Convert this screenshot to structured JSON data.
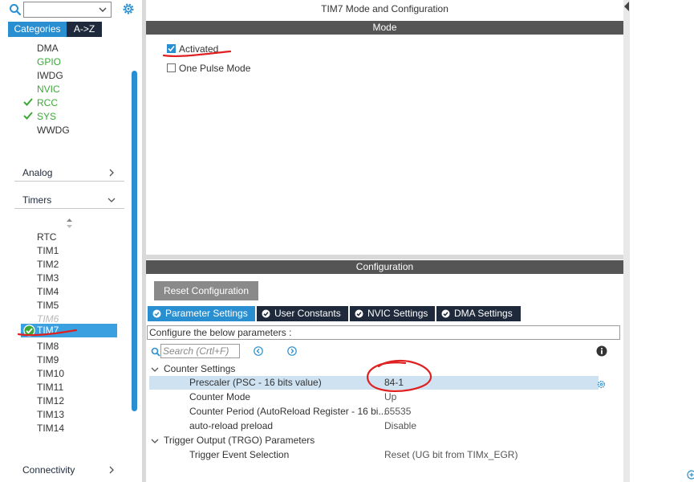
{
  "left_panel": {
    "tabs": {
      "categories": "Categories",
      "az": "A->Z"
    },
    "system_core_items": [
      {
        "label": "DMA",
        "status": "none"
      },
      {
        "label": "GPIO",
        "status": "green"
      },
      {
        "label": "IWDG",
        "status": "none"
      },
      {
        "label": "NVIC",
        "status": "green"
      },
      {
        "label": "RCC",
        "status": "checked"
      },
      {
        "label": "SYS",
        "status": "checked"
      },
      {
        "label": "WWDG",
        "status": "none"
      }
    ],
    "sections": {
      "analog": "Analog",
      "timers": "Timers",
      "connectivity": "Connectivity"
    },
    "timers_items": [
      "RTC",
      "TIM1",
      "TIM2",
      "TIM3",
      "TIM4",
      "TIM5",
      "TIM6",
      "TIM7",
      "TIM8",
      "TIM9",
      "TIM10",
      "TIM11",
      "TIM12",
      "TIM13",
      "TIM14"
    ],
    "selected_item": "TIM7",
    "disabled_item": "TIM6"
  },
  "mode_panel": {
    "title": "TIM7 Mode and Configuration",
    "header": "Mode",
    "activated": {
      "label": "Activated",
      "checked": true
    },
    "one_pulse": {
      "label": "One Pulse Mode",
      "checked": false
    }
  },
  "config_panel": {
    "header": "Configuration",
    "reset_button": "Reset Configuration",
    "tabs": [
      "Parameter Settings",
      "User Constants",
      "NVIC Settings",
      "DMA Settings"
    ],
    "active_tab": "Parameter Settings",
    "description": "Configure the below parameters :",
    "search_placeholder": "Search (Crtl+F)",
    "groups": [
      {
        "title": "Counter Settings",
        "params": [
          {
            "name": "Prescaler (PSC - 16 bits value)",
            "value": "84-1"
          },
          {
            "name": "Counter Mode",
            "value": "Up"
          },
          {
            "name": "Counter Period (AutoReload Register - 16 bi...",
            "value": "65535"
          },
          {
            "name": "auto-reload preload",
            "value": "Disable"
          }
        ]
      },
      {
        "title": "Trigger Output (TRGO) Parameters",
        "params": [
          {
            "name": "Trigger Event Selection",
            "value": "Reset (UG bit from TIMx_EGR)"
          }
        ]
      }
    ]
  },
  "colors": {
    "accent_blue": "#2a8fd0",
    "dark_navy": "#1e2a3b",
    "green": "#3aa935",
    "header_gray": "#555555",
    "annotation_red": "#e02020"
  }
}
